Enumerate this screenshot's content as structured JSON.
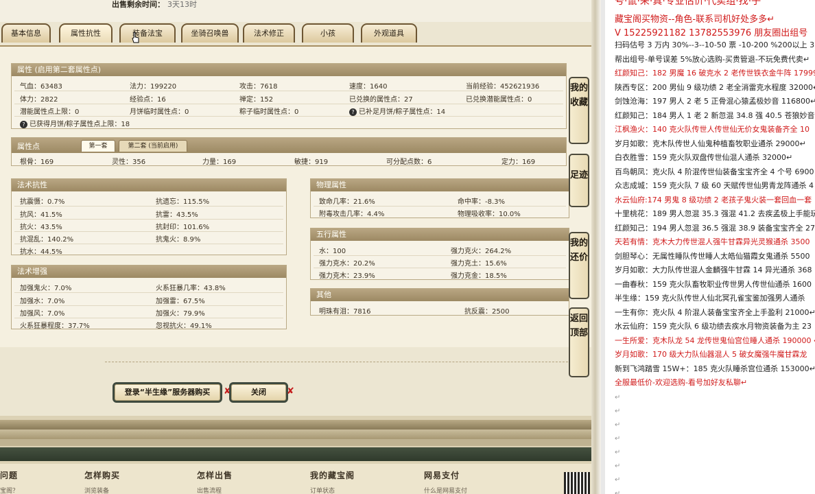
{
  "header": {
    "remaining_label": "出售剩余时间：",
    "remaining_value": "3天13时"
  },
  "tabs": [
    {
      "label": "基本信息"
    },
    {
      "label": "属性抗性"
    },
    {
      "label": "装备法宝"
    },
    {
      "label": "坐骑召唤兽"
    },
    {
      "label": "法术修正"
    },
    {
      "label": "小孩"
    },
    {
      "label": "外观道具"
    }
  ],
  "attributes": {
    "title": "属性 (启用第二套属性点)",
    "row1": [
      "气血：63483",
      "法力：199220",
      "攻击：7618",
      "速度：1640",
      "当前经验：452621936"
    ],
    "row2": [
      "体力：2822",
      "经验点：16",
      "禅定：152",
      "已兑换的属性点：27",
      "已兑换潜能属性点：0"
    ],
    "row3": [
      "潜能属性点上限：0",
      "月饼临时属性点：0",
      "粽子临时属性点：0",
      "已补足月饼/粽子属性点：14"
    ],
    "row4": "已获得月饼/粽子属性点上限：18"
  },
  "points": {
    "title": "属性点",
    "tab1": "第一套",
    "tab2": "第二套 (当前启用)",
    "values": [
      "根骨：169",
      "灵性：356",
      "力量：169",
      "敏捷：919",
      "可分配点数：6",
      "定力：169"
    ]
  },
  "spell_resist": {
    "title": "法术抗性",
    "items": [
      [
        "抗震慑：0.7%",
        "抗遗忘：115.5%"
      ],
      [
        "抗风：41.5%",
        "抗雷：43.5%"
      ],
      [
        "抗火：43.5%",
        "抗封印：101.6%"
      ],
      [
        "抗混乱：140.2%",
        "抗鬼火：8.9%"
      ],
      [
        "抗水：44.5%",
        ""
      ]
    ]
  },
  "spell_boost": {
    "title": "法术增强",
    "items": [
      [
        "加强鬼火：7.0%",
        "火系狂暴几率：43.8%"
      ],
      [
        "加强水：7.0%",
        "加强雷：67.5%"
      ],
      [
        "加强风：7.0%",
        "加强火：79.9%"
      ],
      [
        "火系狂暴程度：37.7%",
        "忽视抗火：49.1%"
      ]
    ]
  },
  "physical": {
    "title": "物理属性",
    "items": [
      [
        "致命几率：21.6%",
        "命中率：-8.3%"
      ],
      [
        "附毒攻击几率：4.4%",
        "物理吸收率：10.0%"
      ]
    ]
  },
  "elements": {
    "title": "五行属性",
    "items": [
      [
        "水：100",
        "强力克火：264.2%"
      ],
      [
        "强力克水：20.2%",
        "强力克土：15.6%"
      ],
      [
        "强力克木：23.9%",
        "强力克金：18.5%"
      ]
    ]
  },
  "other": {
    "title": "其他",
    "items": [
      "明珠有泪：7816",
      "抗反震：2500"
    ]
  },
  "buttons": {
    "buy": "登录“半生缘”服务器购买",
    "close": "关闭"
  },
  "sidebar": [
    "我的收藏",
    "足迹",
    "我的还价",
    "返回顶部"
  ],
  "footer": {
    "cols": [
      {
        "head": "问题",
        "sub": "宝阁？"
      },
      {
        "head": "怎样购买",
        "sub": "浏览装备"
      },
      {
        "head": "怎样出售",
        "sub": "出售流程"
      },
      {
        "head": "我的藏宝阁",
        "sub": "订单状态"
      },
      {
        "head": "网易支付",
        "sub": "什么是网易支付"
      }
    ]
  },
  "document": {
    "top_partial": "号·鼠·来·真·专业估价·代卖组·找·子",
    "lines": [
      {
        "text": "藏宝阁买物资--角色-联系司机好处多多↵",
        "color": "red"
      },
      {
        "text": "V 15225921182    13782553976 朋友圈出组号",
        "color": "red"
      },
      {
        "text": "扫码估号 3 万内 30%--3--10-50 票   -10-200 %200以上 3",
        "color": "black"
      },
      {
        "text": "帮出组号-单号误差 5%放心选购-买贵管退-不玩免费代卖↵",
        "color": "black"
      },
      {
        "text": "红颜知己：182 男魔 16 破克水 2 老传世铁衣金牛阵 17999",
        "color": "red"
      },
      {
        "text": "陕西专区：200 男仙 9 级功绩 2 老全消雷克水程度 32000↵",
        "color": "black"
      },
      {
        "text": "剑蚀沧海：197 男人 2 老 5 正骨混心猿孟极妙音 116800↵",
        "color": "black"
      },
      {
        "text": "红颜知己：184 男人 1 老 2 新忽混 34.8 强 40.5 苍狼妙音 22",
        "color": "black"
      },
      {
        "text": "江枫渔火：140 克火队传世人传世仙无价女鬼装备齐全 10",
        "color": "red"
      },
      {
        "text": "岁月如歌：克木队传世人仙鬼种植畜牧职业通杀 29000↵",
        "color": "black"
      },
      {
        "text": "白衣胜雪：159 克火队双盘传世仙混人通杀 32000↵",
        "color": "black"
      },
      {
        "text": "百鸟朝凤：克火队 4 阶混传世仙装备宝宝齐全 4 个号 6900",
        "color": "black"
      },
      {
        "text": "众志成城：159 克火队 7 级 60 天赋传世仙男青龙阵通杀 4",
        "color": "black"
      },
      {
        "text": "水云仙府:174 男鬼 8 级功绩 2 老孩子鬼火装一套回血一套",
        "color": "red"
      },
      {
        "text": "十里桃花：189 男人忽混 35.3 强混 41.2 去疾孟极上手能玩",
        "color": "black"
      },
      {
        "text": "红颜知己：194 男人忽混 36.5 强混 38.9 装备宝宝齐全 275",
        "color": "black"
      },
      {
        "text": "天若有情：克木大力传世混人强牛甘霖异光灵猴通杀 3500",
        "color": "red"
      },
      {
        "text": "剑胆琴心：无属性睡队传世睡人太皓仙猫霞女鬼通杀 5500",
        "color": "black"
      },
      {
        "text": "岁月如歌：大力队传世混人金麟强牛甘霖 14 异光通杀 368",
        "color": "black"
      },
      {
        "text": "一曲春秋：159 克火队畜牧职业传世男人传世仙通杀 1600",
        "color": "black"
      },
      {
        "text": "半生缘：159 克火队传世人仙北冥孔雀宝鉴加强男人通杀",
        "color": "black"
      },
      {
        "text": "一生有你：克火队 4 阶混人装备宝宝齐全上手盈利 21000↵",
        "color": "black"
      },
      {
        "text": "水云仙府：159 克火队 6 级功绩去疾水月物资装备为主 23",
        "color": "black"
      },
      {
        "text": "一生所爱：克木队龙 54 龙传世鬼仙宫位睡人通杀 190000 ↵",
        "color": "red"
      },
      {
        "text": "岁月如歌：170 级大力队仙器混人 5 破女魔强牛魔甘霖龙",
        "color": "red"
      },
      {
        "text": "新到飞鸿踏雪 15W+：185 克火队睡杀宫位通杀 153000↵",
        "color": "black"
      },
      {
        "text": "全服最低价-欢迎选购-看号加好友私聊↵",
        "color": "red"
      }
    ],
    "empty_marks": [
      "↵",
      "↵",
      "↵",
      "↵",
      "↵",
      "↵",
      "↵",
      "↵"
    ]
  }
}
